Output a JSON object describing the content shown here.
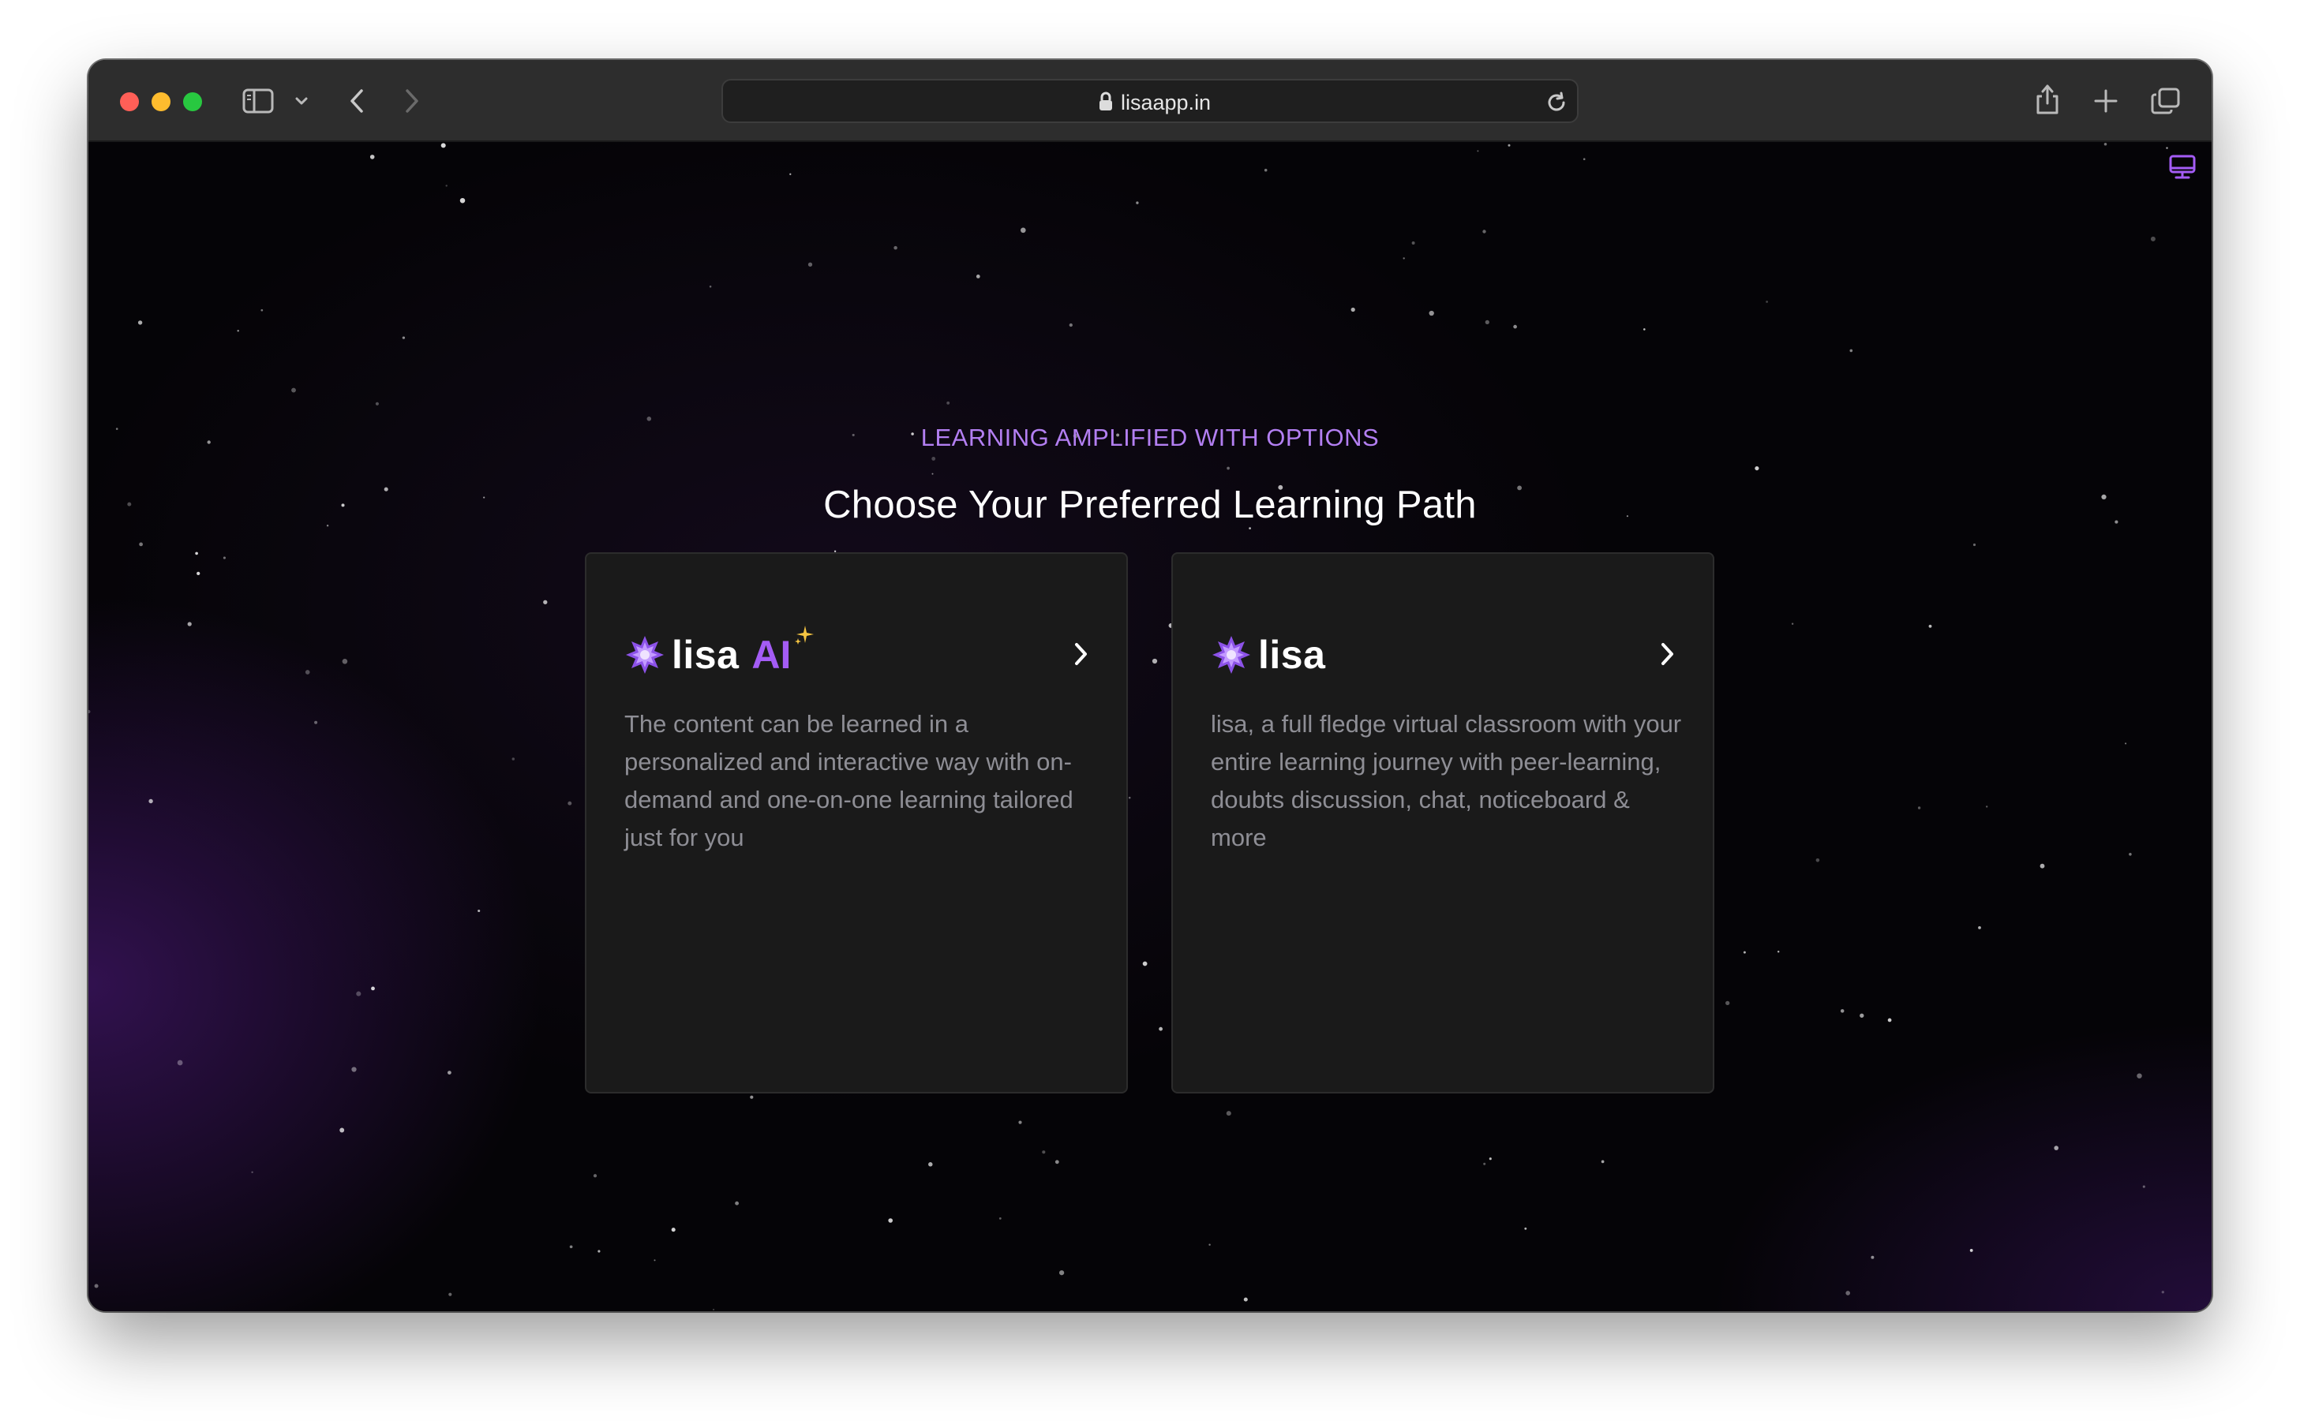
{
  "browser": {
    "url": "lisaapp.in",
    "icons": [
      "sidebar-icon",
      "chevron-down-icon",
      "back-icon",
      "forward-icon",
      "lock-icon",
      "reload-icon",
      "share-icon",
      "new-tab-icon",
      "tab-overview-icon"
    ]
  },
  "page": {
    "eyebrow": "LEARNING AMPLIFIED WITH OPTIONS",
    "headline": "Choose Your Preferred Learning Path",
    "cards": [
      {
        "brand": "lisa",
        "badge": "AI",
        "description": "The content can be learned in a personalized and interactive way with on-demand and one-on-one learning tailored just for you"
      },
      {
        "brand": "lisa",
        "description": "lisa, a full fledge virtual classroom with your entire learning journey with peer-learning, doubts discussion, chat, noticeboard & more"
      }
    ]
  },
  "colors": {
    "accent_purple": "#a45cf5",
    "eyebrow_purple": "#b37ff2",
    "card_bg": "#1a1a1a",
    "sparkle_gold": "#f5c542"
  }
}
